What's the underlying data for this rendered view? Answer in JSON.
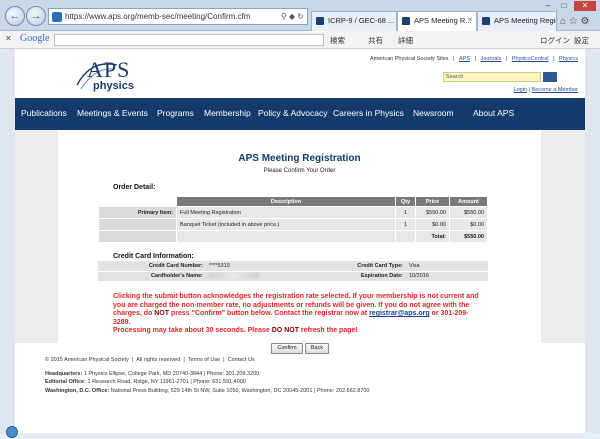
{
  "browser": {
    "url": "https://www.aps.org/memb-sec/meeting/Confirm.cfm",
    "tabs": [
      {
        "label": "ICRP-9 / GEC-68 ..."
      },
      {
        "label": "APS Meeting R..."
      },
      {
        "label": "APS Meeting Regis..."
      }
    ],
    "toolbar": {
      "google": "Google",
      "search_label": "検索",
      "share_label": "共有",
      "more_label": "詳細",
      "login_label": "ログイン",
      "settings_label": "設定"
    }
  },
  "site": {
    "logo_aps": "APS",
    "logo_physics": "physics",
    "top_links": {
      "sites": "American Physical Society Sites",
      "aps": "APS",
      "journals": "Journals",
      "physicscentral": "PhysicsCentral",
      "physics": "Physics"
    },
    "search_placeholder": "Search",
    "login": "Login",
    "become_member": "Become a Member",
    "nav": [
      "Publications",
      "Meetings & Events",
      "Programs",
      "Membership",
      "Policy & Advocacy",
      "Careers in Physics",
      "Newsroom",
      "About APS"
    ]
  },
  "registration": {
    "title": "APS Meeting Registration",
    "subtitle": "Please Confirm Your Order",
    "order_heading": "Order Detail:",
    "columns": [
      "Description",
      "Qty",
      "Price",
      "Amount"
    ],
    "rows": [
      {
        "label": "Primary Item:",
        "description": "Full Meeting Registration",
        "qty": "1",
        "price": "$550.00",
        "amount": "$550.00"
      },
      {
        "label": "",
        "description": "Banquet Ticket (included in above price.)",
        "qty": "1",
        "price": "$0.00",
        "amount": "$0.00"
      }
    ],
    "total_label": "Total:",
    "total_value": "$550.00",
    "cc_heading": "Credit Card Information:",
    "cc": {
      "number_label": "Credit Card Number:",
      "number_value": "****5319",
      "type_label": "Credit Card Type:",
      "type_value": "Visa",
      "holder_label": "Cardholder's Name:",
      "expiration_label": "Expiration Date:",
      "expiration_value": "10/2016"
    },
    "notice": {
      "p1a": "Clicking the submit button acknowledges the registration rate selected. If your membership is not current and you are charged the non-member rate, no adjustments or refunds will be given. If you do not agree with the charges, do ",
      "p1_not": "NOT",
      "p1b": " press \"Confirm\" button below. Contact the registrar now at ",
      "email": "registrar@aps.org",
      "p1c": " or 301-209-3289.",
      "p2a": "Processing may take about 30 seconds. Please ",
      "p2_not": "DO NOT",
      "p2b": " refresh the page!"
    },
    "confirm_label": "Confirm",
    "back_label": "Back"
  },
  "footer": {
    "copyright": "© 2015 American Physical Society",
    "rights": "All rights reserved",
    "terms": "Terms of Use",
    "contact": "Contact Us",
    "hq_label": "Headquarters:",
    "hq": "1 Physics Ellipse, College Park, MD 20740-3844 | Phone: 301.209.3200",
    "editorial_label": "Editorial Office:",
    "editorial": "1 Research Road, Ridge, NY 11961-2701 | Phone: 631.591.4000",
    "dc_label": "Washington, D.C. Office:",
    "dc": "National Press Building, 529 14th St NW, Suite 1050, Washington, DC 20045-2001 | Phone: 202.662.8700"
  }
}
